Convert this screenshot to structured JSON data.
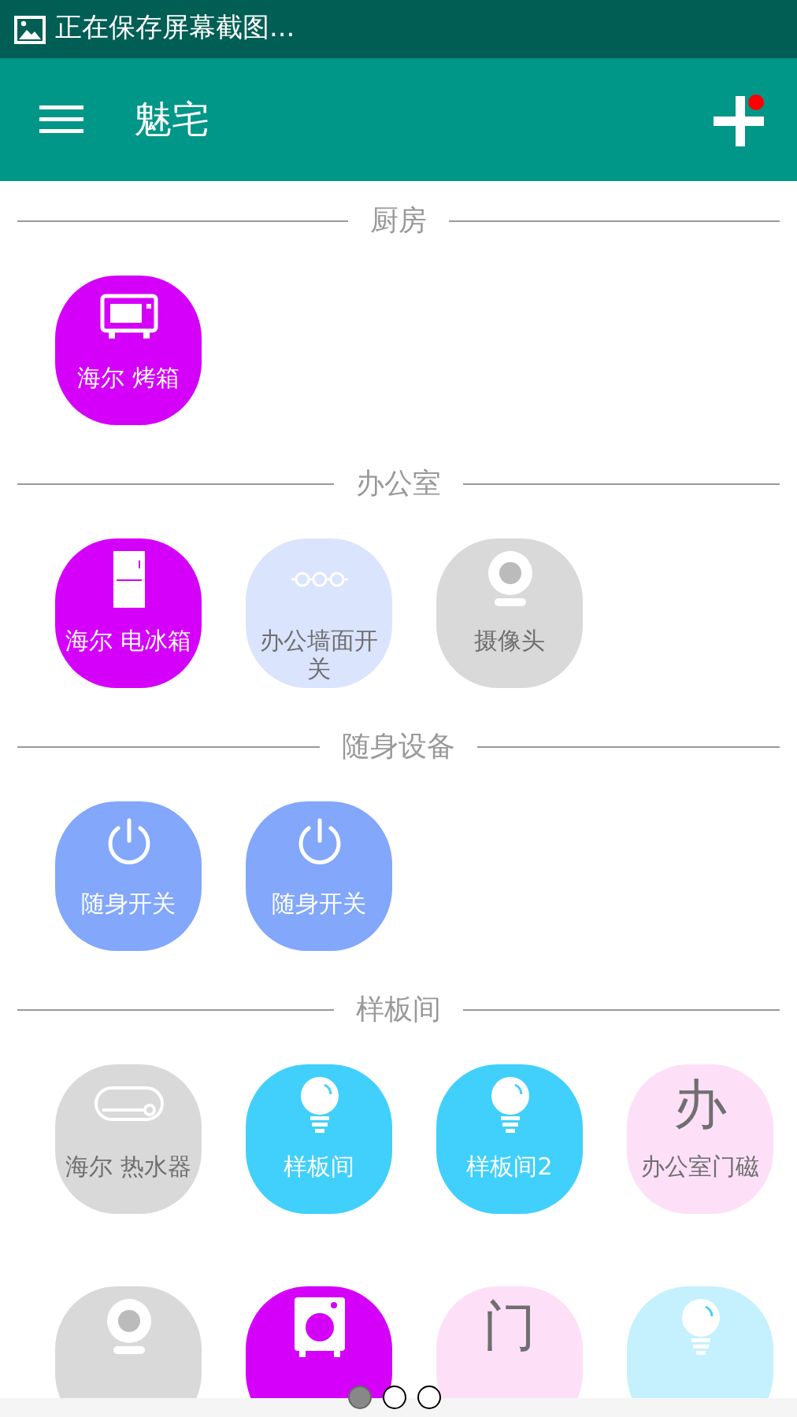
{
  "status_bar": {
    "text": "正在保存屏幕截图..."
  },
  "app_bar": {
    "title": "魅宅"
  },
  "sections": [
    {
      "title": "厨房",
      "devices": [
        {
          "kind": "oven",
          "label": "海尔 烤箱",
          "color": "#d500f9"
        }
      ]
    },
    {
      "title": "办公室",
      "devices": [
        {
          "kind": "fridge",
          "label": "海尔 电冰箱",
          "color": "#d500f9"
        },
        {
          "kind": "switch",
          "label": "办公墙面开关",
          "color": "#dae4fd"
        },
        {
          "kind": "camera",
          "label": "摄像头",
          "color": "#d9d9d9"
        }
      ]
    },
    {
      "title": "随身设备",
      "devices": [
        {
          "kind": "power",
          "label": "随身开关",
          "color": "#82a7fb"
        },
        {
          "kind": "power",
          "label": "随身开关",
          "color": "#82a7fb"
        }
      ]
    },
    {
      "title": "样板间",
      "devices": [
        {
          "kind": "heater",
          "label": "海尔 热水器",
          "color": "#d9d9d9"
        },
        {
          "kind": "bulb",
          "label": "样板间",
          "color": "#40d0fb"
        },
        {
          "kind": "bulb",
          "label": "样板间2",
          "color": "#40d0fb"
        },
        {
          "kind": "glyph",
          "glyph": "办",
          "label": "办公室门磁",
          "color": "#fde0f8"
        },
        {
          "kind": "camera",
          "color": "#d9d9d9"
        },
        {
          "kind": "washer",
          "color": "#d500f9"
        },
        {
          "kind": "glyph",
          "glyph": "门",
          "color": "#fde0f8"
        },
        {
          "kind": "bulb",
          "color": "#c4f1fd"
        }
      ]
    }
  ],
  "pager": [
    {
      "selected": true
    },
    {
      "selected": false
    },
    {
      "selected": false
    }
  ]
}
